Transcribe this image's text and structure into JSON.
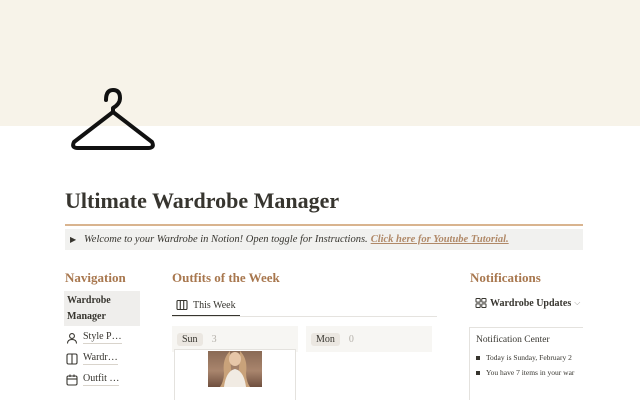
{
  "page": {
    "title": "Ultimate Wardrobe Manager",
    "icon": "hanger-icon",
    "cover_color": "#f7f3e9",
    "accent_color": "#a8774e"
  },
  "callout": {
    "text": "Welcome to your Wardrobe in Notion! Open toggle for Instructions.",
    "link_text": "Click here for Youtube Tutorial."
  },
  "navigation": {
    "heading": "Navigation",
    "active_item": "Wardrobe Manager",
    "items": [
      {
        "label": "Style P…",
        "icon": "person-icon"
      },
      {
        "label": "Wardr…",
        "icon": "columns-icon"
      },
      {
        "label": "Outfit …",
        "icon": "calendar-icon"
      }
    ]
  },
  "outfits": {
    "heading": "Outfits of the Week",
    "view_tab": {
      "label": "This Week",
      "icon": "board-icon"
    },
    "columns": [
      {
        "day": "Sun",
        "count": "3"
      },
      {
        "day": "Mon",
        "count": "0"
      }
    ]
  },
  "notifications": {
    "heading": "Notifications",
    "database": {
      "label": "Wardrobe Updates",
      "icon": "gallery-icon"
    },
    "card": {
      "title": "Notification Center",
      "lines": [
        "Today is Sunday, February 2",
        "You have 7 items in your war"
      ]
    }
  }
}
